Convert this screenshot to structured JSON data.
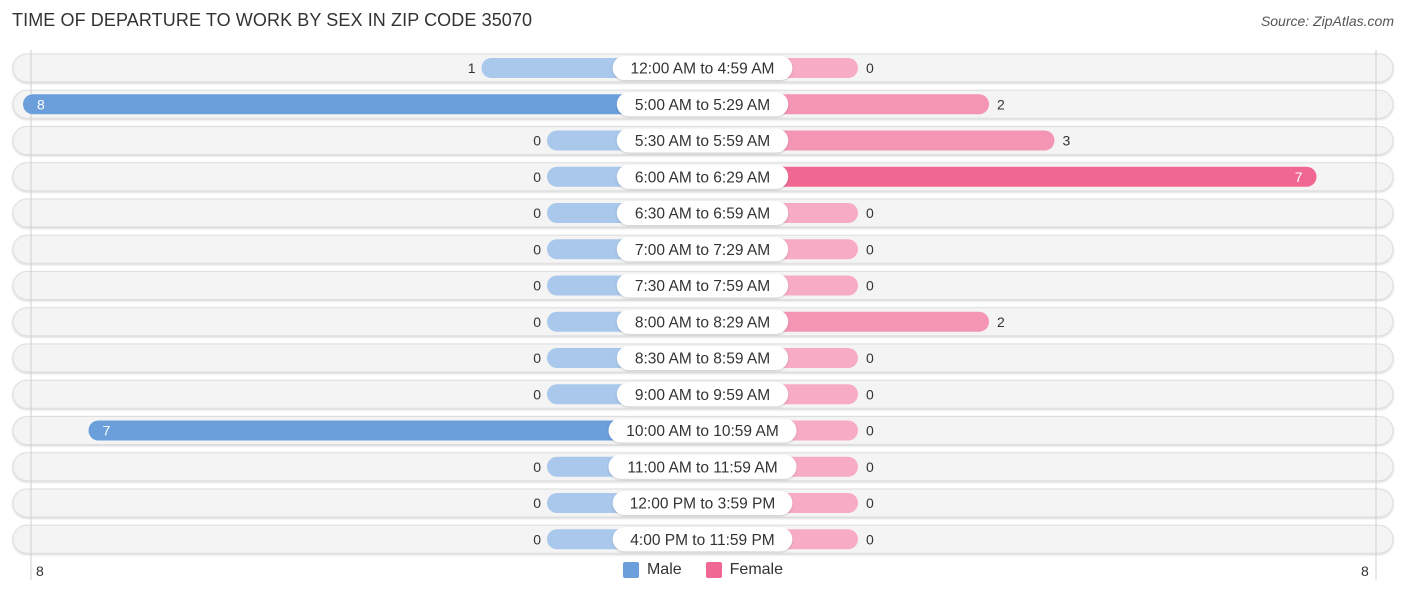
{
  "chart_data": {
    "type": "bar",
    "orientation": "horizontal-diverging",
    "title": "TIME OF DEPARTURE TO WORK BY SEX IN ZIP CODE 35070",
    "source": "Source: ZipAtlas.com",
    "categories": [
      "12:00 AM to 4:59 AM",
      "5:00 AM to 5:29 AM",
      "5:30 AM to 5:59 AM",
      "6:00 AM to 6:29 AM",
      "6:30 AM to 6:59 AM",
      "7:00 AM to 7:29 AM",
      "7:30 AM to 7:59 AM",
      "8:00 AM to 8:29 AM",
      "8:30 AM to 8:59 AM",
      "9:00 AM to 9:59 AM",
      "10:00 AM to 10:59 AM",
      "11:00 AM to 11:59 AM",
      "12:00 PM to 3:59 PM",
      "4:00 PM to 11:59 PM"
    ],
    "series": [
      {
        "name": "Male",
        "side": "left",
        "color": "#6a9fdb",
        "light_color": "#a9c8eb",
        "values": [
          1,
          8,
          0,
          0,
          0,
          0,
          0,
          0,
          0,
          0,
          7,
          0,
          0,
          0
        ]
      },
      {
        "name": "Female",
        "side": "right",
        "color": "#f06892",
        "light_color": "#f7abc5",
        "values": [
          0,
          2,
          3,
          7,
          0,
          0,
          0,
          2,
          0,
          0,
          0,
          0,
          0,
          0
        ]
      }
    ],
    "xlim": [
      0,
      8
    ],
    "axis_tick_left": "8",
    "axis_tick_right": "8",
    "legend": [
      "Male",
      "Female"
    ],
    "legend_position": "bottom-center"
  }
}
